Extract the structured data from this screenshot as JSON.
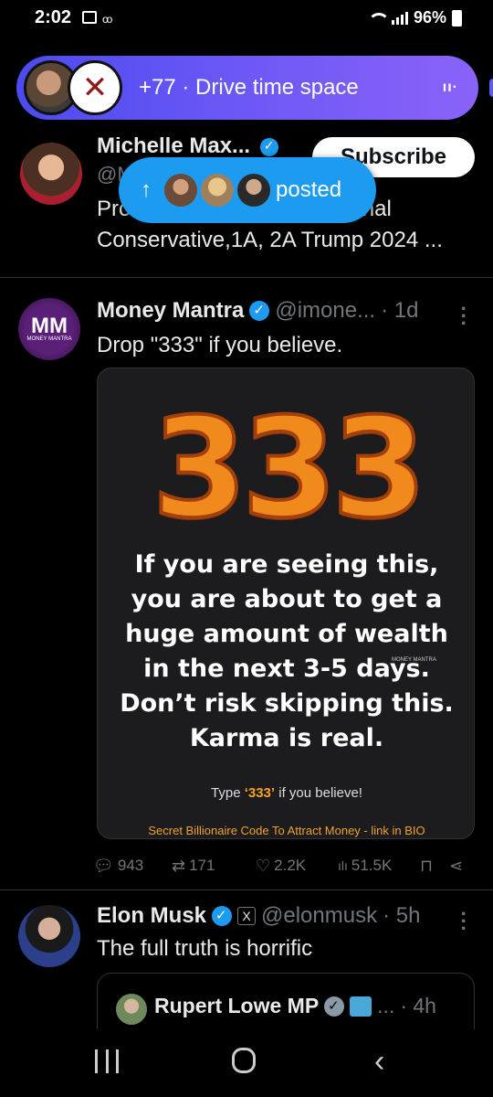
{
  "status_bar": {
    "time": "2:02",
    "battery": "96%"
  },
  "spaces": {
    "title": "+77 · Drive time space",
    "wave": "ıı·"
  },
  "profile": {
    "name": "Michelle Max...",
    "handle": "@M",
    "bio_line1": "Pro                                    onal",
    "bio_line2": "Conservative,1A, 2A Trump 2024 ...",
    "subscribe_label": "Subscribe"
  },
  "posted_pill": {
    "arrow": "↑",
    "label": "posted"
  },
  "tweet1": {
    "name": "Money Mantra",
    "handle": "@imone...",
    "time": "· 1d",
    "text": "Drop \"333\" if you believe.",
    "avatar_text": "MM",
    "avatar_subtext": "MONEY MANTRA",
    "card": {
      "number": "333",
      "lines": [
        "If you are seeing this,",
        "you are about to get a",
        "huge amount of wealth",
        "in the next 3-5 days.",
        "Don’t risk skipping this.",
        "Karma is real."
      ],
      "watermark": "MONEY MANTRA",
      "type_prefix": "Type ",
      "type_value": "‘333’",
      "type_suffix": " if you believe!",
      "footer": "Secret Billionaire Code To Attract Money - link in BIO"
    },
    "actions": {
      "replies": "943",
      "reposts": "171",
      "likes": "2.2K",
      "views": "51.5K"
    }
  },
  "tweet2": {
    "name": "Elon Musk",
    "handle": "@elonmusk",
    "time": "· 5h",
    "text": "The full truth is horrific",
    "x_badge": "X",
    "quote": {
      "name": "Rupert Lowe MP",
      "ellipsis": "...",
      "time": "· 4h"
    }
  },
  "icons": {
    "reply": "reply-icon",
    "repost": "repost-icon",
    "like": "heart-icon",
    "views": "views-icon",
    "bookmark": "bookmark-icon",
    "share": "share-icon"
  },
  "colors": {
    "accent": "#1d9bf0",
    "spaces_start": "#4b4bf0",
    "spaces_end": "#8a63f8",
    "orange": "#f08a1c"
  }
}
